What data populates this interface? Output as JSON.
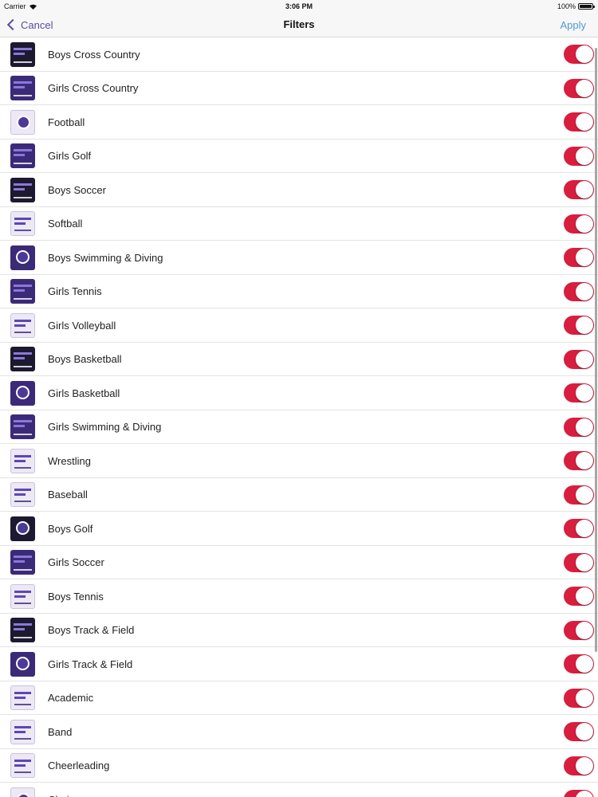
{
  "status_bar": {
    "carrier": "Carrier",
    "time": "3:06 PM",
    "battery": "100%",
    "battery_level": 1.0
  },
  "nav": {
    "cancel_label": "Cancel",
    "title": "Filters",
    "apply_label": "Apply"
  },
  "colors": {
    "toggle_on": "#d81e3e",
    "nav_cancel": "#5b4aa8",
    "nav_apply": "#4a9bd6"
  },
  "filters": [
    {
      "label": "Boys Cross Country",
      "on": true
    },
    {
      "label": "Girls Cross Country",
      "on": true
    },
    {
      "label": "Football",
      "on": true
    },
    {
      "label": "Girls Golf",
      "on": true
    },
    {
      "label": "Boys Soccer",
      "on": true
    },
    {
      "label": "Softball",
      "on": true
    },
    {
      "label": "Boys Swimming & Diving",
      "on": true
    },
    {
      "label": "Girls Tennis",
      "on": true
    },
    {
      "label": "Girls Volleyball",
      "on": true
    },
    {
      "label": "Boys Basketball",
      "on": true
    },
    {
      "label": "Girls Basketball",
      "on": true
    },
    {
      "label": "Girls Swimming & Diving",
      "on": true
    },
    {
      "label": "Wrestling",
      "on": true
    },
    {
      "label": "Baseball",
      "on": true
    },
    {
      "label": "Boys Golf",
      "on": true
    },
    {
      "label": "Girls Soccer",
      "on": true
    },
    {
      "label": "Boys Tennis",
      "on": true
    },
    {
      "label": "Boys Track & Field",
      "on": true
    },
    {
      "label": "Girls Track & Field",
      "on": true
    },
    {
      "label": "Academic",
      "on": true
    },
    {
      "label": "Band",
      "on": true
    },
    {
      "label": "Cheerleading",
      "on": true
    },
    {
      "label": "Choir",
      "on": true
    }
  ]
}
